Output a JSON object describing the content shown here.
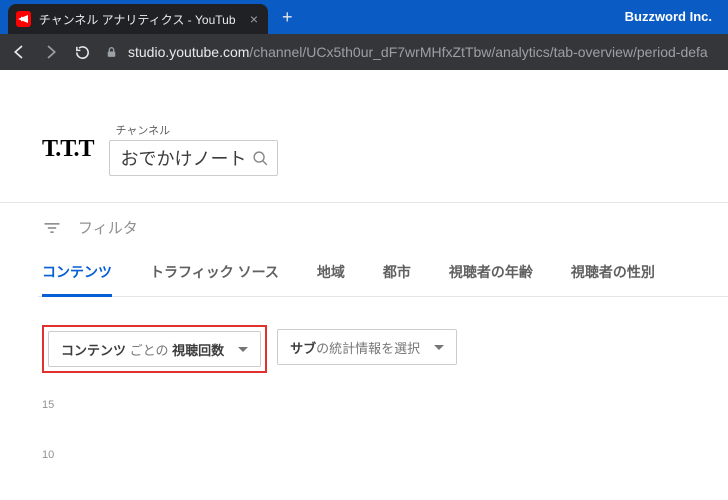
{
  "browser": {
    "tab_title": "チャンネル アナリティクス - YouTube S",
    "titlebar_right": "Buzzword Inc.",
    "url_host": "studio.youtube.com",
    "url_path": "/channel/UCx5th0ur_dF7wrMHfxZtTbw/analytics/tab-overview/period-defa"
  },
  "header": {
    "logo": "T.T.T",
    "channel_label": "チャンネル",
    "channel_name": "おでかけノート"
  },
  "filter_label": "フィルタ",
  "tabs": {
    "t0": "コンテンツ",
    "t1": "トラフィック ソース",
    "t2": "地域",
    "t3": "都市",
    "t4": "視聴者の年齢",
    "t5": "視聴者の性別"
  },
  "dropdowns": {
    "primary_a": "コンテンツ",
    "primary_b": "ごとの",
    "primary_c": "視聴回数",
    "secondary_a": "サブ",
    "secondary_b": "の統計情報を選択"
  },
  "chart_data": {
    "type": "line",
    "yticks": [
      "15",
      "10"
    ],
    "ylim": [
      0,
      15
    ]
  }
}
